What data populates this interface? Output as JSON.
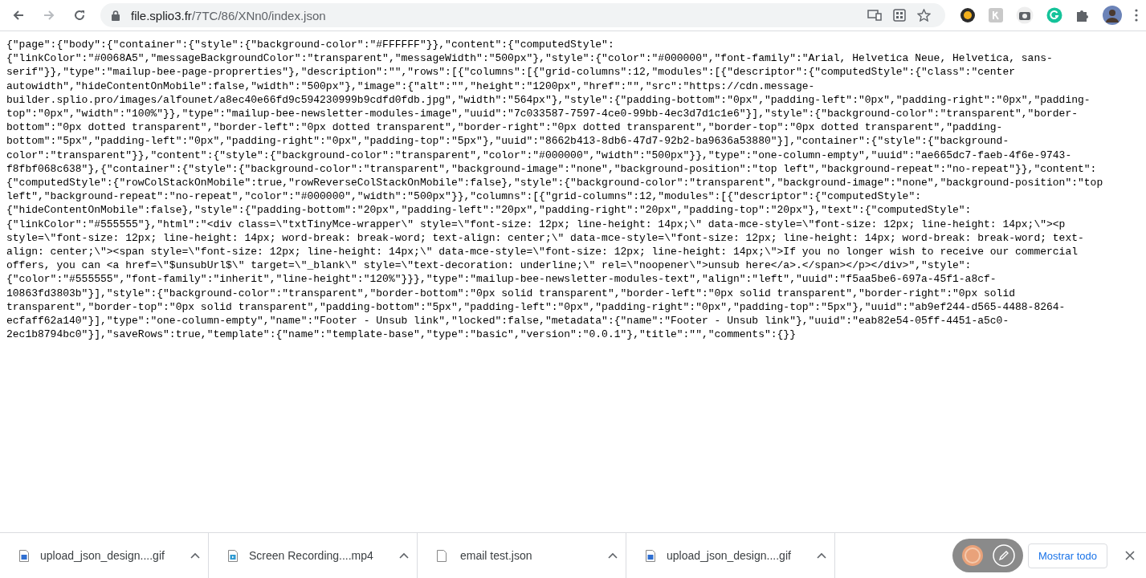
{
  "toolbar": {
    "url_host": "file.splio3.fr",
    "url_path": "/7TC/86/XNn0/index.json"
  },
  "document_lines": [
    "{\"page\":{\"body\":{\"container\":{\"style\":{\"background-color\":\"#FFFFFF\"}},\"content\":{\"computedStyle\":",
    "{\"linkColor\":\"#0068A5\",\"messageBackgroundColor\":\"transparent\",\"messageWidth\":\"500px\"},\"style\":{\"color\":\"#000000\",\"font-family\":\"Arial, Helvetica Neue, Helvetica, sans-",
    "serif\"}},\"type\":\"mailup-bee-page-proprerties\"},\"description\":\"\",\"rows\":[{\"columns\":[{\"grid-columns\":12,\"modules\":[{\"descriptor\":{\"computedStyle\":{\"class\":\"center",
    "autowidth\",\"hideContentOnMobile\":false,\"width\":\"500px\"},\"image\":{\"alt\":\"\",\"height\":\"1200px\",\"href\":\"\",\"src\":\"https://cdn.message-",
    "builder.splio.pro/images/alfounet/a8ec40e66fd9c594230999b9cdfd0fdb.jpg\",\"width\":\"564px\"},\"style\":{\"padding-bottom\":\"0px\",\"padding-left\":\"0px\",\"padding-right\":\"0px\",\"padding-",
    "top\":\"0px\",\"width\":\"100%\"}},\"type\":\"mailup-bee-newsletter-modules-image\",\"uuid\":\"7c033587-7597-4ce0-99bb-4ec3d7d1c1e6\"}],\"style\":{\"background-color\":\"transparent\",\"border-",
    "bottom\":\"0px dotted transparent\",\"border-left\":\"0px dotted transparent\",\"border-right\":\"0px dotted transparent\",\"border-top\":\"0px dotted transparent\",\"padding-",
    "bottom\":\"5px\",\"padding-left\":\"0px\",\"padding-right\":\"0px\",\"padding-top\":\"5px\"},\"uuid\":\"8662b413-8db6-47d7-92b2-ba9636a53880\"}],\"container\":{\"style\":{\"background-",
    "color\":\"transparent\"}},\"content\":{\"style\":{\"background-color\":\"transparent\",\"color\":\"#000000\",\"width\":\"500px\"}},\"type\":\"one-column-empty\",\"uuid\":\"ae665dc7-faeb-4f6e-9743-",
    "f8fbf068c638\"},{\"container\":{\"style\":{\"background-color\":\"transparent\",\"background-image\":\"none\",\"background-position\":\"top left\",\"background-repeat\":\"no-repeat\"}},\"content\":",
    "{\"computedStyle\":{\"rowColStackOnMobile\":true,\"rowReverseColStackOnMobile\":false},\"style\":{\"background-color\":\"transparent\",\"background-image\":\"none\",\"background-position\":\"top",
    "left\",\"background-repeat\":\"no-repeat\",\"color\":\"#000000\",\"width\":\"500px\"}},\"columns\":[{\"grid-columns\":12,\"modules\":[{\"descriptor\":{\"computedStyle\":",
    "{\"hideContentOnMobile\":false},\"style\":{\"padding-bottom\":\"20px\",\"padding-left\":\"20px\",\"padding-right\":\"20px\",\"padding-top\":\"20px\"},\"text\":{\"computedStyle\":",
    "{\"linkColor\":\"#555555\"},\"html\":\"<div class=\\\"txtTinyMce-wrapper\\\" style=\\\"font-size: 12px; line-height: 14px;\\\" data-mce-style=\\\"font-size: 12px; line-height: 14px;\\\"><p",
    "style=\\\"font-size: 12px; line-height: 14px; word-break: break-word; text-align: center;\\\" data-mce-style=\\\"font-size: 12px; line-height: 14px; word-break: break-word; text-",
    "align: center;\\\"><span style=\\\"font-size: 12px; line-height: 14px;\\\" data-mce-style=\\\"font-size: 12px; line-height: 14px;\\\">If you no longer wish to receive our commercial",
    "offers, you can <a href=\\\"$unsubUrl$\\\" target=\\\"_blank\\\" style=\\\"text-decoration: underline;\\\" rel=\\\"noopener\\\">unsub here</a>.</span></p></div>\",\"style\":",
    "{\"color\":\"#555555\",\"font-family\":\"inherit\",\"line-height\":\"120%\"}}},\"type\":\"mailup-bee-newsletter-modules-text\",\"align\":\"left\",\"uuid\":\"f5aa5be6-697a-45f1-a8cf-",
    "10863fd3803b\"}],\"style\":{\"background-color\":\"transparent\",\"border-bottom\":\"0px solid transparent\",\"border-left\":\"0px solid transparent\",\"border-right\":\"0px solid",
    "transparent\",\"border-top\":\"0px solid transparent\",\"padding-bottom\":\"5px\",\"padding-left\":\"0px\",\"padding-right\":\"0px\",\"padding-top\":\"5px\"},\"uuid\":\"ab9ef244-d565-4488-8264-",
    "ecfaff62a140\"}],\"type\":\"one-column-empty\",\"name\":\"Footer - Unsub link\",\"locked\":false,\"metadata\":{\"name\":\"Footer - Unsub link\"},\"uuid\":\"eab82e54-05ff-4451-a5c0-",
    "2ec1b8794bc0\"}],\"saveRows\":true,\"template\":{\"name\":\"template-base\",\"type\":\"basic\",\"version\":\"0.0.1\"},\"title\":\"\",\"comments\":{}}"
  ],
  "downloads": [
    {
      "kind": "image",
      "name": "upload_json_design....gif"
    },
    {
      "kind": "video",
      "name": "Screen Recording....mp4"
    },
    {
      "kind": "file",
      "name": "email test.json"
    },
    {
      "kind": "image",
      "name": "upload_json_design....gif"
    }
  ],
  "show_all_button": "Mostrar todo"
}
